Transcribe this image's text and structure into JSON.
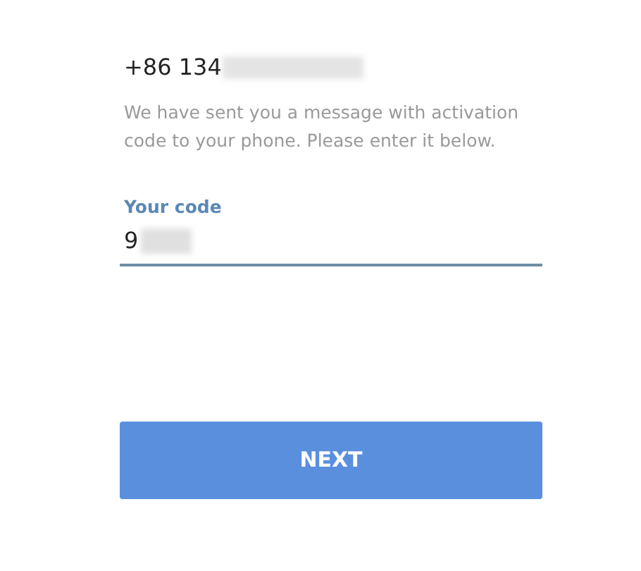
{
  "phone_number": "+86 134",
  "message": "We have sent you a message with activation code to your phone. Please enter it below.",
  "code_field": {
    "label": "Your code",
    "value": "9"
  },
  "next_button": {
    "label": "NEXT"
  }
}
